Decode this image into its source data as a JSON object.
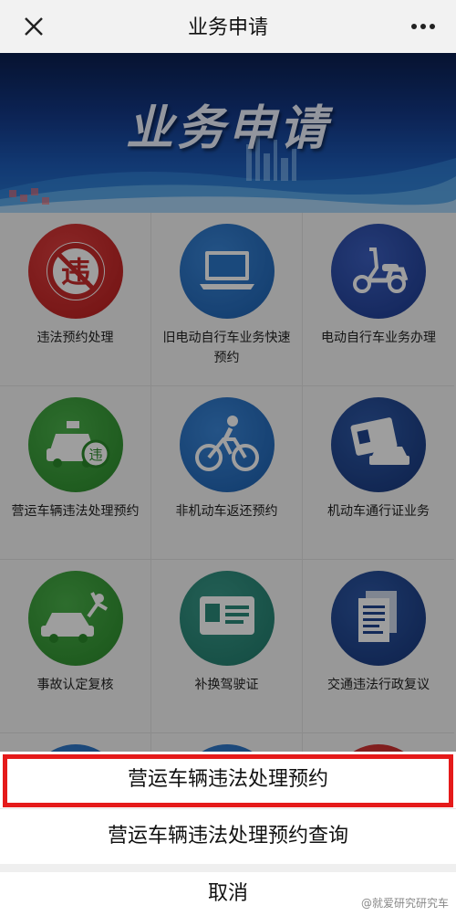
{
  "topbar": {
    "title": "业务申请",
    "close_icon": "close-icon",
    "more_icon": "more-icon"
  },
  "banner": {
    "title": "业务申请"
  },
  "services": [
    {
      "label": "违法预约处理",
      "icon": "violation-icon",
      "color": "#c92a2a"
    },
    {
      "label": "旧电动自行车业务快速预约",
      "icon": "laptop-icon",
      "color": "#2a77c8"
    },
    {
      "label": "电动自行车业务办理",
      "icon": "scooter-icon",
      "color": "#2a4ea8"
    },
    {
      "label": "营运车辆违法处理预约",
      "icon": "taxi-icon",
      "color": "#3a9c3a"
    },
    {
      "label": "非机动车返还预约",
      "icon": "bicycle-icon",
      "color": "#2a77c8"
    },
    {
      "label": "机动车通行证业务",
      "icon": "vehicle-pass-icon",
      "color": "#1f4590"
    },
    {
      "label": "事故认定复核",
      "icon": "accident-icon",
      "color": "#3a9c3a"
    },
    {
      "label": "补换驾驶证",
      "icon": "license-card-icon",
      "color": "#2a8a7a"
    },
    {
      "label": "交通违法行政复议",
      "icon": "document-icon",
      "color": "#1f4590"
    }
  ],
  "sheet": {
    "option1": "营运车辆违法处理预约",
    "option2": "营运车辆违法处理预约查询",
    "cancel": "取消",
    "highlight_color": "#e51a1a"
  },
  "watermark": "@就爱研究研究车"
}
